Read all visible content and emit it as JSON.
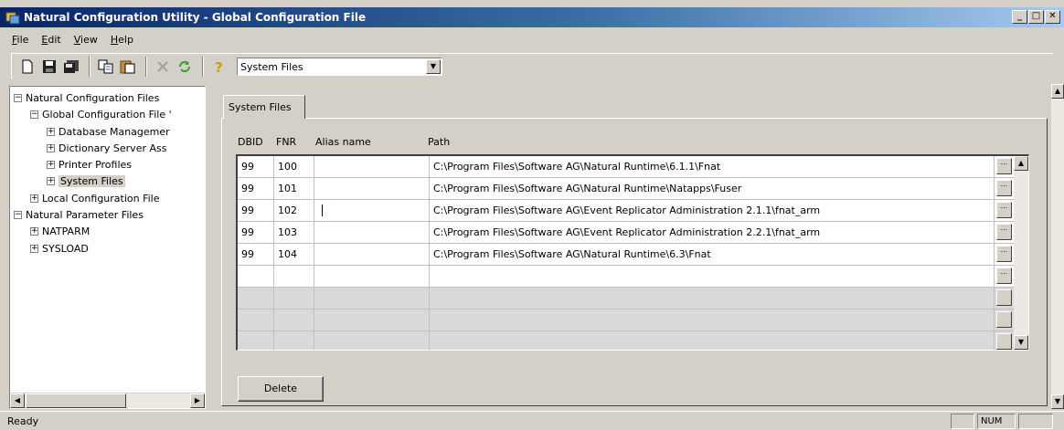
{
  "window": {
    "title": "Natural Configuration Utility - Global Configuration File",
    "controls": [
      "minimize",
      "maximize",
      "close"
    ]
  },
  "menu": {
    "items": [
      "File",
      "Edit",
      "View",
      "Help"
    ]
  },
  "toolbar": {
    "icons": [
      "new-icon",
      "save-icon",
      "save-all-icon",
      "copy-icon",
      "paste-icon",
      "delete-icon",
      "refresh-icon",
      "help-icon"
    ],
    "combo_value": "System Files"
  },
  "tree": {
    "nodes": [
      {
        "label": "Natural Configuration Files",
        "expander": "−"
      },
      {
        "label": "Global Configuration File '",
        "expander": "−"
      },
      {
        "label": "Database Managemer",
        "expander": "+"
      },
      {
        "label": "Dictionary Server Ass",
        "expander": "+"
      },
      {
        "label": "Printer Profiles",
        "expander": "+"
      },
      {
        "label": "System Files",
        "expander": "+",
        "selected": true
      },
      {
        "label": "Local Configuration File",
        "expander": "+"
      },
      {
        "label": "Natural Parameter Files",
        "expander": "−"
      },
      {
        "label": "NATPARM",
        "expander": "+"
      },
      {
        "label": "SYSLOAD",
        "expander": "+"
      }
    ]
  },
  "panel": {
    "tab_label": "System Files",
    "columns": {
      "dbid": "DBID",
      "fnr": "FNR",
      "alias": "Alias name",
      "path": "Path"
    },
    "rows": [
      {
        "dbid": "99",
        "fnr": "100",
        "alias": "",
        "path": "C:\\Program Files\\Software AG\\Natural Runtime\\6.1.1\\Fnat"
      },
      {
        "dbid": "99",
        "fnr": "101",
        "alias": "",
        "path": "C:\\Program Files\\Software AG\\Natural Runtime\\Natapps\\Fuser"
      },
      {
        "dbid": "99",
        "fnr": "102",
        "alias": "",
        "path": "C:\\Program Files\\Software AG\\Event Replicator Administration 2.1.1\\fnat_arm"
      },
      {
        "dbid": "99",
        "fnr": "103",
        "alias": "",
        "path": "C:\\Program Files\\Software AG\\Event Replicator Administration 2.2.1\\fnat_arm"
      },
      {
        "dbid": "99",
        "fnr": "104",
        "alias": "",
        "path": "C:\\Program Files\\Software AG\\Natural Runtime\\6.3\\Fnat"
      }
    ],
    "ellipsis_label": "...",
    "delete_label": "Delete"
  },
  "status": {
    "text": "Ready",
    "num_indicator": "NUM"
  }
}
